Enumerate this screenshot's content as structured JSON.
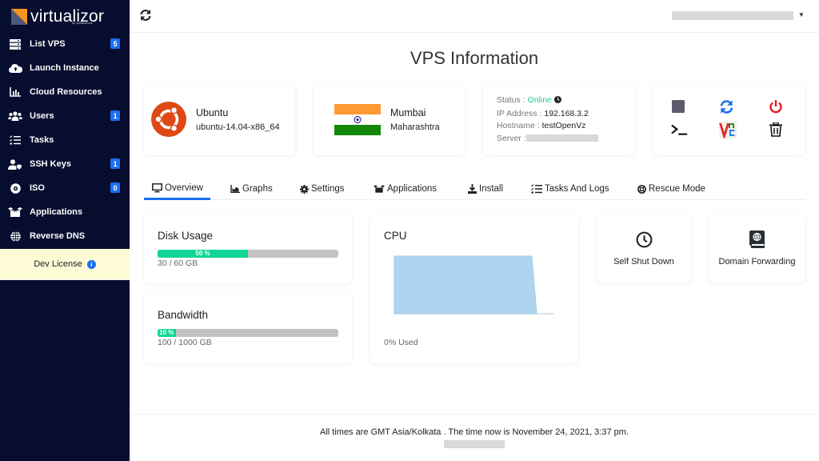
{
  "brand": {
    "name": "virtualizor",
    "sub": "by softaculous"
  },
  "sidebar": {
    "items": [
      {
        "label": "List VPS",
        "icon": "server-icon",
        "badge": "5"
      },
      {
        "label": "Launch Instance",
        "icon": "cloud-upload-icon"
      },
      {
        "label": "Cloud Resources",
        "icon": "chart-bar-icon"
      },
      {
        "label": "Users",
        "icon": "users-icon",
        "badge": "1"
      },
      {
        "label": "Tasks",
        "icon": "tasks-icon"
      },
      {
        "label": "SSH Keys",
        "icon": "user-shield-icon",
        "badge": "1"
      },
      {
        "label": "ISO",
        "icon": "disc-icon",
        "badge": "0"
      },
      {
        "label": "Applications",
        "icon": "box-open-icon"
      },
      {
        "label": "Reverse DNS",
        "icon": "globe-icon"
      }
    ],
    "license": "Dev License"
  },
  "page": {
    "title": "VPS Information"
  },
  "os": {
    "name": "Ubuntu",
    "version": "ubuntu-14.04-x86_64"
  },
  "location": {
    "city": "Mumbai",
    "region": "Maharashtra"
  },
  "status": {
    "status_label": "Status :",
    "status_value": "Online",
    "ip_label": "IP Address :",
    "ip_value": "192.168.3.2",
    "host_label": "Hostname :",
    "host_value": "testOpenVz",
    "server_label": "Server :"
  },
  "actions": [
    "stop",
    "restart",
    "power-off",
    "console",
    "vnc",
    "delete"
  ],
  "tabs": [
    {
      "label": "Overview",
      "active": true
    },
    {
      "label": "Graphs"
    },
    {
      "label": "Settings"
    },
    {
      "label": "Applications"
    },
    {
      "label": "Install"
    },
    {
      "label": "Tasks And Logs"
    },
    {
      "label": "Rescue Mode"
    }
  ],
  "disk": {
    "title": "Disk Usage",
    "percent": 50,
    "percent_label": "50 %",
    "caption": "30 / 60 GB"
  },
  "bandwidth": {
    "title": "Bandwidth",
    "percent": 10,
    "percent_label": "10 %",
    "caption": "100 / 1000 GB"
  },
  "cpu": {
    "title": "CPU",
    "caption": "0% Used",
    "series": [
      100,
      100,
      100,
      100,
      100,
      100,
      100,
      100,
      100,
      100,
      100,
      100,
      100,
      100,
      0,
      0
    ]
  },
  "quick": [
    {
      "label": "Self Shut Down"
    },
    {
      "label": "Domain Forwarding"
    }
  ],
  "footer": {
    "text": "All times are GMT Asia/Kolkata . The time now is November 24, 2021, 3:37 pm."
  },
  "colors": {
    "accent": "#1b6ef3",
    "online": "#1ecf8c",
    "progress": "#10d596",
    "sidebar": "#070d2e"
  }
}
